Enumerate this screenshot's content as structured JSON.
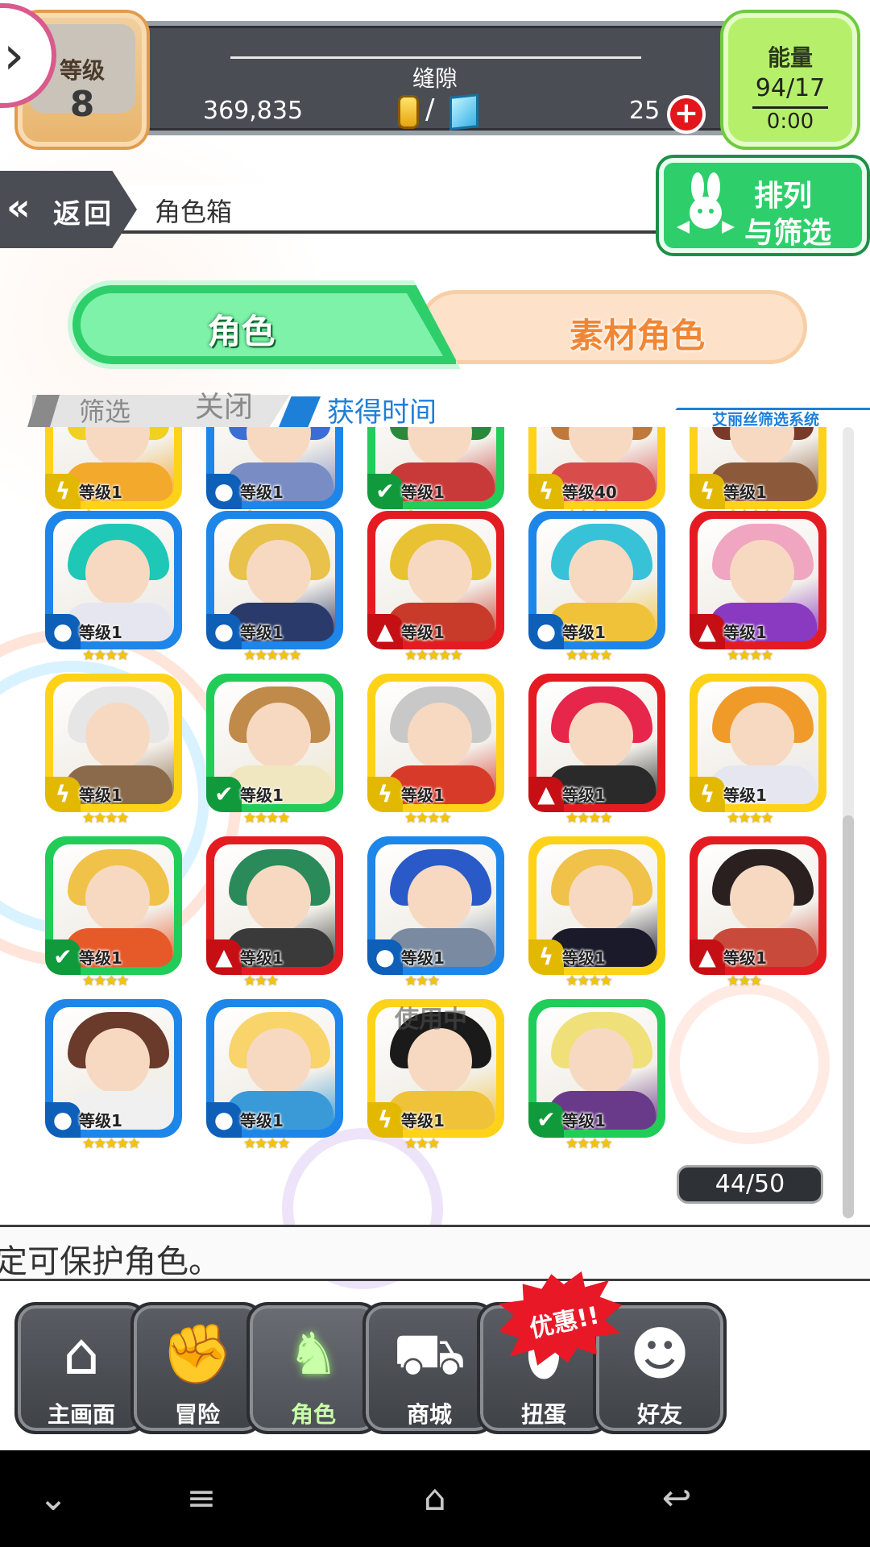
{
  "status": {
    "level_label": "等级",
    "level_value": "8",
    "stage_name": "缝隙",
    "coins": "369,835",
    "currency_separator": "/",
    "gems": "25",
    "energy_label": "能量",
    "energy_value": "94/17",
    "energy_timer": "0:00"
  },
  "header": {
    "back_label": "返回",
    "title": "角色箱",
    "sort_filter_line1": "排列",
    "sort_filter_line2": "与筛选"
  },
  "tabs": {
    "character": "角色",
    "material": "素材角色"
  },
  "filter": {
    "label": "筛选",
    "state": "关闭",
    "sort_order": "获得时间",
    "system_label": "艾丽丝筛选系统"
  },
  "grid": {
    "rows": [
      [
        {
          "ring": "yellow",
          "element": "thunder",
          "level": "等级1",
          "stars": "★",
          "hair": "#f0d020",
          "outfit": "#f3a92c"
        },
        {
          "ring": "blue",
          "element": "water",
          "level": "等级1",
          "stars": "★",
          "hair": "#3a6ed6",
          "outfit": "#7a8cc4"
        },
        {
          "ring": "green",
          "element": "wind",
          "level": "等级1",
          "stars": "★",
          "hair": "#2a8a3a",
          "outfit": "#c83a3a"
        },
        {
          "ring": "yellow",
          "element": "thunder",
          "level": "等级40",
          "stars": "★★★★",
          "hair": "#c0793a",
          "outfit": "#d84c4c"
        },
        {
          "ring": "yellow",
          "element": "thunder",
          "level": "等级1",
          "stars": "★★★★★",
          "hair": "#7a3a2a",
          "outfit": "#8c5a3a"
        }
      ],
      [
        {
          "ring": "blue",
          "element": "water",
          "level": "等级1",
          "stars": "★★★★",
          "hair": "#1fc7b6",
          "outfit": "#e6e6f0"
        },
        {
          "ring": "blue",
          "element": "water",
          "level": "等级1",
          "stars": "★★★★★",
          "hair": "#e8c24a",
          "outfit": "#2a3a6a"
        },
        {
          "ring": "red",
          "element": "fire",
          "level": "等级1",
          "stars": "★★★★★",
          "hair": "#e8c232",
          "outfit": "#c83a2a"
        },
        {
          "ring": "blue",
          "element": "water",
          "level": "等级1",
          "stars": "★★★★",
          "hair": "#38c2d8",
          "outfit": "#f0c23a"
        },
        {
          "ring": "red",
          "element": "fire",
          "level": "等级1",
          "stars": "★★★★",
          "hair": "#f0a6c0",
          "outfit": "#8a3ac0"
        }
      ],
      [
        {
          "ring": "yellow",
          "element": "thunder",
          "level": "等级1",
          "stars": "★★★★",
          "hair": "#e6e6e6",
          "outfit": "#8a6a4a"
        },
        {
          "ring": "green",
          "element": "wind",
          "level": "等级1",
          "stars": "★★★★",
          "hair": "#c08a4a",
          "outfit": "#f0e6c0"
        },
        {
          "ring": "yellow",
          "element": "thunder",
          "level": "等级1",
          "stars": "★★★★",
          "hair": "#c8c8c8",
          "outfit": "#d83a2a"
        },
        {
          "ring": "red",
          "element": "fire",
          "level": "等级1",
          "stars": "★★★★",
          "hair": "#e6264a",
          "outfit": "#2a2a2a"
        },
        {
          "ring": "yellow",
          "element": "thunder",
          "level": "等级1",
          "stars": "★★★★",
          "hair": "#f09a2a",
          "outfit": "#e6e6f0"
        }
      ],
      [
        {
          "ring": "green",
          "element": "wind",
          "level": "等级1",
          "stars": "★★★★",
          "hair": "#f0c24a",
          "outfit": "#e65a2a"
        },
        {
          "ring": "red",
          "element": "fire",
          "level": "等级1",
          "stars": "★★★",
          "hair": "#2a8a5a",
          "outfit": "#3a3a3a"
        },
        {
          "ring": "blue",
          "element": "water",
          "level": "等级1",
          "stars": "★★★",
          "hair": "#2a5ac8",
          "outfit": "#7a8aa0"
        },
        {
          "ring": "yellow",
          "element": "thunder",
          "level": "等级1",
          "stars": "★★★★",
          "hair": "#f0c24a",
          "outfit": "#1a1a2a"
        },
        {
          "ring": "red",
          "element": "fire",
          "level": "等级1",
          "stars": "★★★",
          "hair": "#2a2020",
          "outfit": "#c84a3a"
        }
      ],
      [
        {
          "ring": "blue",
          "element": "water",
          "level": "等级1",
          "stars": "★★★★★",
          "hair": "#6a3a2a",
          "outfit": "#f0f0f0"
        },
        {
          "ring": "blue",
          "element": "water",
          "level": "等级1",
          "stars": "★★★★",
          "hair": "#f8d46a",
          "outfit": "#3a9ad8"
        },
        {
          "ring": "yellow",
          "element": "thunder",
          "level": "等级1",
          "stars": "★★★",
          "hair": "#1a1a1a",
          "outfit": "#f0c23a",
          "in_use": "使用中"
        },
        {
          "ring": "green",
          "element": "wind",
          "level": "等级1",
          "stars": "★★★★",
          "hair": "#f0e07a",
          "outfit": "#6a3a8a"
        }
      ]
    ]
  },
  "count": "44/50",
  "tip": "定可保护角色。",
  "bottom_nav": [
    {
      "label": "主画面",
      "icon": "home-icon"
    },
    {
      "label": "冒险",
      "icon": "handshake-icon"
    },
    {
      "label": "角色",
      "icon": "rabbit-icon",
      "active": true
    },
    {
      "label": "商城",
      "icon": "cart-icon"
    },
    {
      "label": "扭蛋",
      "icon": "egg-icon"
    },
    {
      "label": "好友",
      "icon": "friends-icon"
    }
  ],
  "promo_badge": "优惠!!",
  "colors": {
    "yellow": "#ffd21a",
    "blue": "#1d86e8",
    "red": "#e41c22",
    "green": "#22cc58",
    "accent_green": "#2ecf6b",
    "accent_orange": "#f08634"
  }
}
